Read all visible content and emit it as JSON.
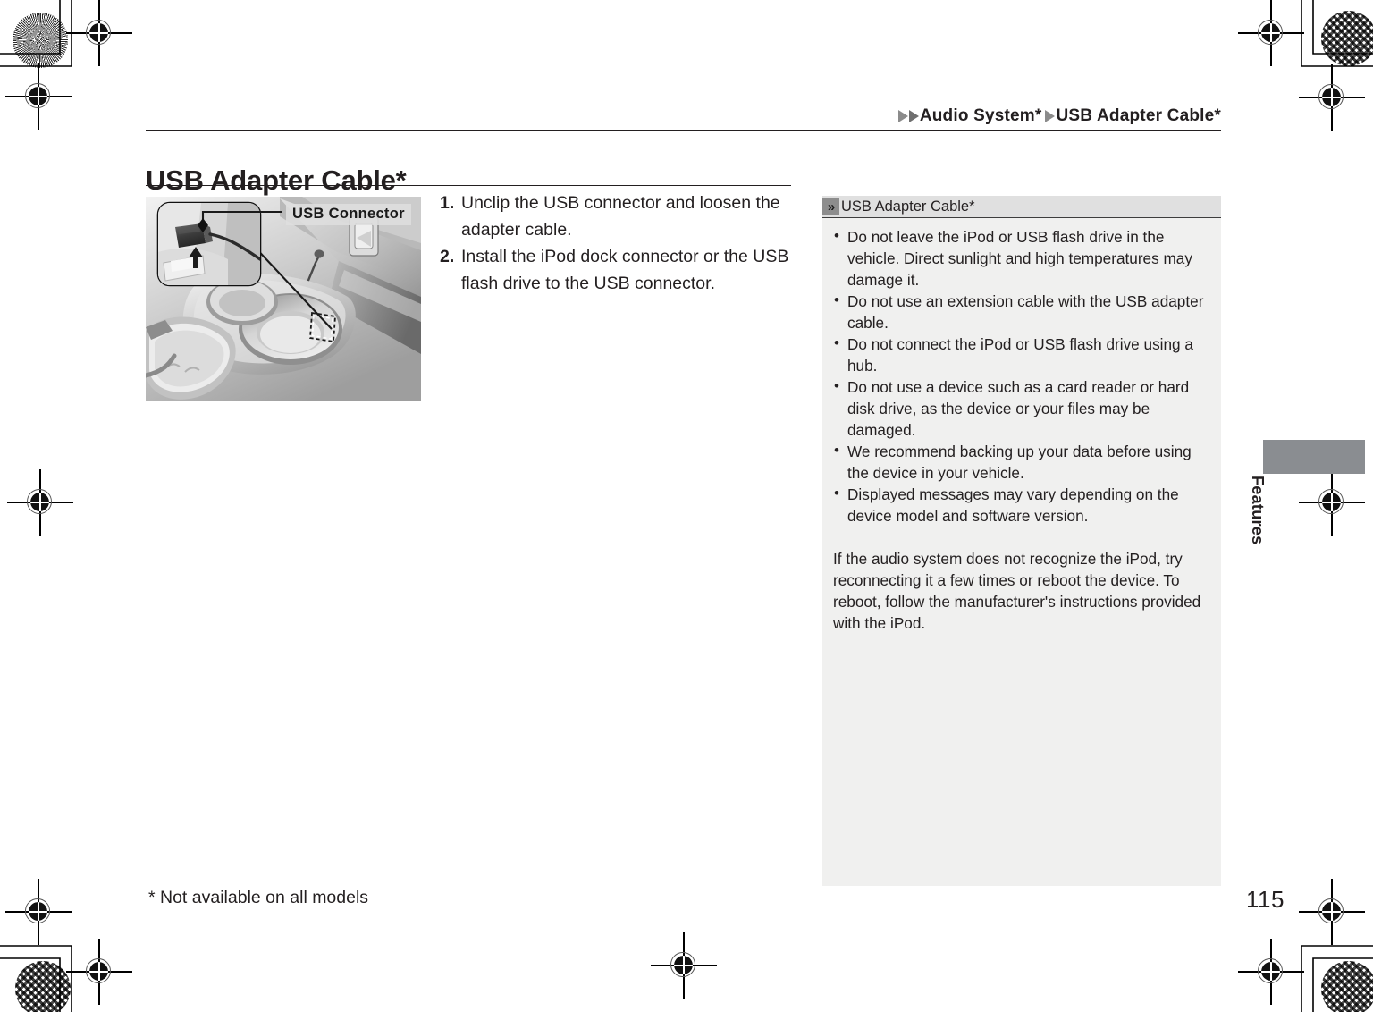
{
  "document": {
    "page_number": "115",
    "side_tab_label": "Features",
    "footnote": "* Not available on all models"
  },
  "breadcrumb": {
    "item1": "Audio System*",
    "item2": "USB Adapter Cable*"
  },
  "header": {
    "title": "USB Adapter Cable*"
  },
  "figure": {
    "callout_label": "USB Connector",
    "alt": "Center console with magnified inset showing the USB connector and adapter cable"
  },
  "steps": [
    {
      "num": "1.",
      "text": "Unclip the USB connector and loosen the adapter cable."
    },
    {
      "num": "2.",
      "text": "Install the iPod dock connector or the USB flash drive to the USB connector."
    }
  ],
  "note": {
    "badge": "»",
    "title": "USB Adapter Cable*",
    "bullets": [
      "Do not leave the iPod or USB flash drive in the vehicle. Direct sunlight and high temperatures may damage it.",
      "Do not use an extension cable with the USB adapter cable.",
      "Do not connect the iPod or USB flash drive using a hub.",
      "Do not use a device such as a card reader or hard disk drive, as the device or your files may be damaged.",
      "We recommend backing up your data before using the device in your vehicle.",
      "Displayed messages may vary depending on the device model and software version."
    ],
    "paragraph": "If the audio system does not recognize the iPod, try reconnecting it a few times or reboot the device. To reboot, follow the manufacturer's instructions provided with the iPod."
  },
  "colors": {
    "text": "#231f20",
    "note_panel_bg": "#f0f0ef",
    "note_head_bg": "#e0e0e0",
    "badge_bg": "#8d8d8d",
    "side_tab": "#8a8d91",
    "arrow": "#8b8b8b"
  }
}
